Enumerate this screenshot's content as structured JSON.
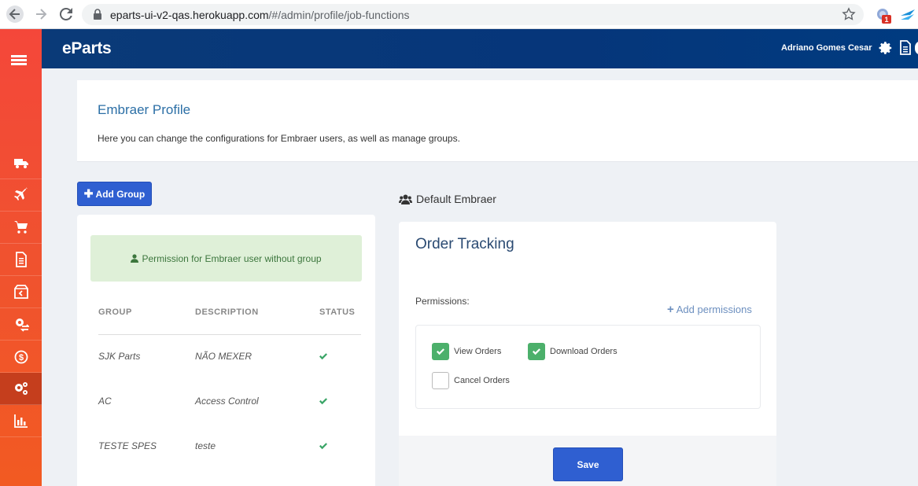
{
  "browser": {
    "url_host": "eparts-ui-v2-qas.herokuapp.com",
    "url_path": "/#/admin/profile/job-functions",
    "extension_badge": "1"
  },
  "sidebar": {
    "items": [
      {
        "icon": "truck-icon"
      },
      {
        "icon": "plane-icon"
      },
      {
        "icon": "cart-icon"
      },
      {
        "icon": "document-icon"
      },
      {
        "icon": "box-return-icon"
      },
      {
        "icon": "gear-exchange-icon"
      },
      {
        "icon": "dollar-cycle-icon"
      },
      {
        "icon": "cogs-icon",
        "active": true
      },
      {
        "icon": "bar-chart-icon"
      }
    ]
  },
  "header": {
    "brand": "eParts",
    "username": "Adriano Gomes Cesar"
  },
  "profile": {
    "title": "Embraer Profile",
    "description": "Here you can change the configurations for Embraer users, as well as manage groups."
  },
  "groups": {
    "add_group_label": "Add Group",
    "notice": "Permission for Embraer user without group",
    "columns": [
      "GROUP",
      "DESCRIPTION",
      "STATUS"
    ],
    "rows": [
      {
        "group": "SJK Parts",
        "description": "NÃO MEXER",
        "status": "active"
      },
      {
        "group": "AC",
        "description": "Access Control",
        "status": "active"
      },
      {
        "group": "TESTE SPES",
        "description": "teste",
        "status": "active"
      }
    ]
  },
  "selected_group": {
    "name": "Default Embraer",
    "section_title": "Order Tracking",
    "permissions_label": "Permissions:",
    "add_permissions_label": "Add permissions",
    "permissions": [
      {
        "label": "View Orders",
        "checked": true
      },
      {
        "label": "Download Orders",
        "checked": true
      },
      {
        "label": "Cancel Orders",
        "checked": false
      }
    ],
    "save_label": "Save"
  },
  "colors": {
    "sidebar": "#f4473a",
    "header": "#0a3a78",
    "primary_button": "#2f5fd1",
    "success": "#4cb06b",
    "link": "#2c6fa6"
  }
}
